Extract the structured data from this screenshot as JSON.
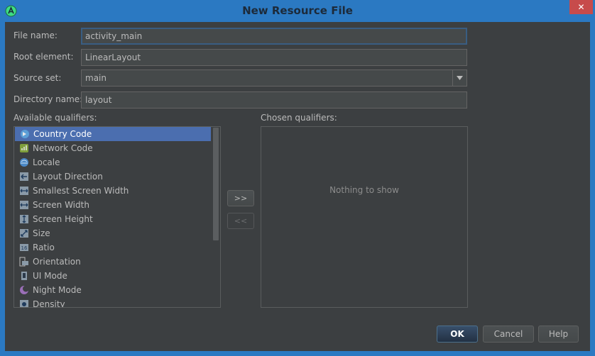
{
  "window": {
    "title": "New Resource File",
    "close_glyph": "✕"
  },
  "form": {
    "file_name": {
      "label": "File name:",
      "value": "activity_main"
    },
    "root_element": {
      "label": "Root element:",
      "value": "LinearLayout"
    },
    "source_set": {
      "label": "Source set:",
      "value": "main"
    },
    "directory_name": {
      "label": "Directory name:",
      "value": "layout"
    }
  },
  "qualifiers": {
    "available_label": "Available qualifiers:",
    "chosen_label": "Chosen qualifiers:",
    "empty_text": "Nothing to show",
    "add_label": ">>",
    "remove_label": "<<",
    "items": [
      {
        "label": "Country Code",
        "icon": "country-code-icon",
        "selected": true
      },
      {
        "label": "Network Code",
        "icon": "network-code-icon"
      },
      {
        "label": "Locale",
        "icon": "locale-icon"
      },
      {
        "label": "Layout Direction",
        "icon": "layout-direction-icon"
      },
      {
        "label": "Smallest Screen Width",
        "icon": "smallest-screen-width-icon"
      },
      {
        "label": "Screen Width",
        "icon": "screen-width-icon"
      },
      {
        "label": "Screen Height",
        "icon": "screen-height-icon"
      },
      {
        "label": "Size",
        "icon": "size-icon"
      },
      {
        "label": "Ratio",
        "icon": "ratio-icon"
      },
      {
        "label": "Orientation",
        "icon": "orientation-icon"
      },
      {
        "label": "UI Mode",
        "icon": "ui-mode-icon"
      },
      {
        "label": "Night Mode",
        "icon": "night-mode-icon"
      },
      {
        "label": "Density",
        "icon": "density-icon"
      }
    ]
  },
  "buttons": {
    "ok": "OK",
    "cancel": "Cancel",
    "help": "Help"
  },
  "colors": {
    "accent": "#2b79c2",
    "selection": "#4b6eaf",
    "background": "#3c3f41"
  }
}
